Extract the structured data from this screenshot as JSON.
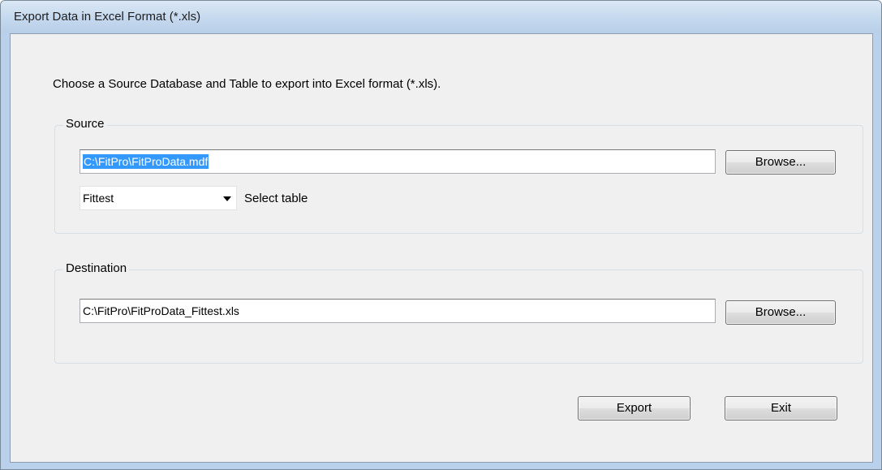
{
  "window": {
    "title": "Export Data in Excel Format (*.xls)"
  },
  "instruction": "Choose a Source Database and Table to export into Excel format (*.xls).",
  "source": {
    "legend": "Source",
    "path_value": "C:\\FitPro\\FitProData.mdf",
    "browse_label": "Browse...",
    "table_selected": "Fittest",
    "select_table_label": "Select table"
  },
  "destination": {
    "legend": "Destination",
    "path_value": "C:\\FitPro\\FitProData_Fittest.xls",
    "browse_label": "Browse..."
  },
  "actions": {
    "export_label": "Export",
    "exit_label": "Exit"
  },
  "colors": {
    "selection": "#3399ff",
    "frame": "#b9d1ea",
    "client_bg": "#f0f0f0"
  }
}
